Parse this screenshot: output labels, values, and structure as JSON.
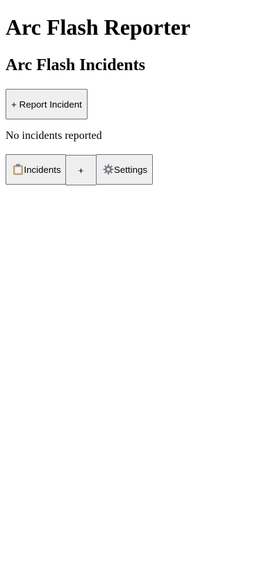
{
  "app": {
    "title": "Arc Flash Reporter"
  },
  "main": {
    "section_title": "Arc Flash Incidents",
    "report_button_label": "+ Report Incident",
    "empty_state": "No incidents reported"
  },
  "bottom_nav": {
    "items": [
      {
        "icon": "clipboard-icon",
        "label": "Incidents"
      },
      {
        "icon": "",
        "label": "+"
      },
      {
        "icon": "gear-icon",
        "label": "Settings"
      }
    ]
  }
}
